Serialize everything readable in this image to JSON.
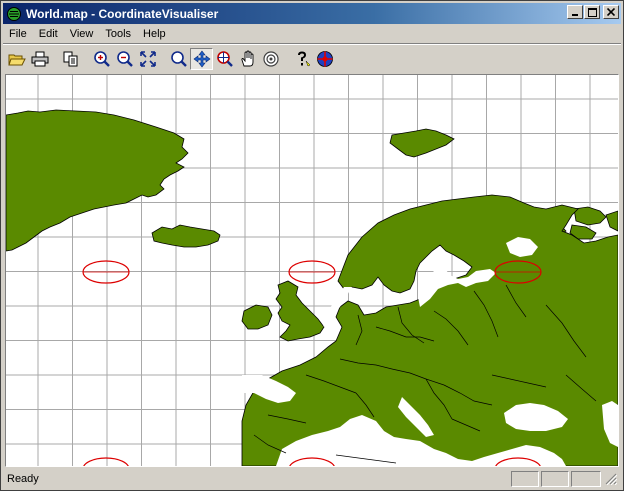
{
  "window": {
    "title": "World.map - CoordinateVisualiser",
    "minimize_icon": "minimize-icon",
    "maximize_icon": "maximize-icon",
    "close_icon": "close-icon"
  },
  "menu": {
    "items": [
      {
        "label": "File"
      },
      {
        "label": "Edit"
      },
      {
        "label": "View"
      },
      {
        "label": "Tools"
      },
      {
        "label": "Help"
      }
    ]
  },
  "toolbar": {
    "buttons": [
      {
        "icon": "open-folder-icon"
      },
      {
        "icon": "print-icon"
      },
      {
        "icon": "copy-icon"
      },
      {
        "icon": "zoom-in-icon"
      },
      {
        "icon": "zoom-out-icon"
      },
      {
        "icon": "zoom-extents-icon"
      },
      {
        "icon": "zoom-window-icon"
      },
      {
        "icon": "pan-move-icon",
        "pressed": true
      },
      {
        "icon": "zoom-target-icon"
      },
      {
        "icon": "hand-icon"
      },
      {
        "icon": "locate-icon"
      },
      {
        "icon": "help-icon"
      },
      {
        "icon": "about-globe-icon"
      }
    ]
  },
  "map": {
    "land_color": "#5a8a00",
    "grid_color": "#a8a8a8",
    "marker_color": "#dd0000",
    "background": "#ffffff"
  },
  "status": {
    "text": "Ready"
  }
}
